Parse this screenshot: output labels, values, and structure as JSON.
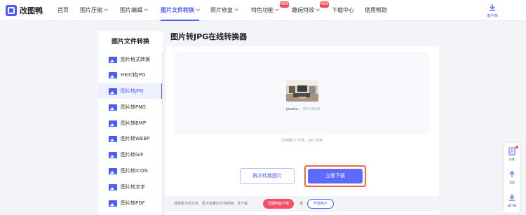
{
  "brand": {
    "name": "改图鸭"
  },
  "nav": {
    "items": [
      {
        "label": "首页",
        "dropdown": false
      },
      {
        "label": "图片压缩",
        "dropdown": true
      },
      {
        "label": "图片编辑",
        "dropdown": true
      },
      {
        "label": "图片文件转换",
        "dropdown": true,
        "active": true
      },
      {
        "label": "照片修复",
        "dropdown": true
      },
      {
        "label": "特色功能",
        "dropdown": true,
        "badge": "NEW"
      },
      {
        "label": "趣玩特效",
        "dropdown": true,
        "badge": "NEW"
      },
      {
        "label": "下载中心",
        "dropdown": false
      },
      {
        "label": "使用帮助",
        "dropdown": false
      }
    ],
    "client_label": "客户端"
  },
  "sidebar": {
    "title": "图片文件转换",
    "items": [
      {
        "label": "图片格式转换"
      },
      {
        "label": "HEIC转JPG"
      },
      {
        "label": "图片转JPG",
        "active": true
      },
      {
        "label": "图片转PNG"
      },
      {
        "label": "图片转BMP"
      },
      {
        "label": "图片转WEBP"
      },
      {
        "label": "图片转GIF"
      },
      {
        "label": "图片转ICON"
      },
      {
        "label": "图片转文字"
      },
      {
        "label": "图片转PDF"
      }
    ]
  },
  "main": {
    "title": "图片转JPG在线转换器",
    "file": {
      "name": "pexels...",
      "size": "993.01KB"
    },
    "summary": "已转换1个文件，共0.78M",
    "again_button": "再次转换图片",
    "download_button": "立即下载"
  },
  "notice": {
    "text": "转换更大的文件、更大批量的文件转换，请下载",
    "client_button": "改图鸭客户端",
    "or": "或",
    "upgrade_button": "升级账户"
  },
  "float_tools": [
    {
      "label": "反馈",
      "icon": "feedback-icon"
    },
    {
      "label": "顶部",
      "icon": "top-icon"
    },
    {
      "label": "客户端",
      "icon": "client-download-icon"
    }
  ],
  "colors": {
    "accent": "#4b5cff",
    "highlight_border": "#f06a3b",
    "badge": "#f24b4b"
  }
}
